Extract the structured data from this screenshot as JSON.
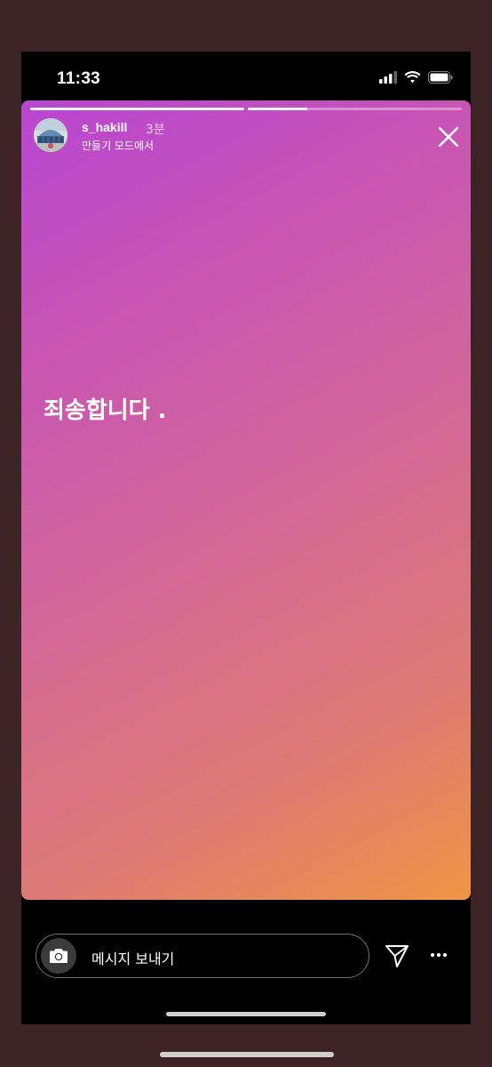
{
  "status_bar": {
    "time": "11:33",
    "icons": [
      "cellular-signal-icon",
      "wifi-icon",
      "battery-icon"
    ]
  },
  "story": {
    "segments_progress": [
      1.0,
      0.28
    ],
    "username": "s_hakill",
    "time_ago": "3분",
    "subtitle": "만들기 모드에서",
    "text": "죄송합니다 .",
    "gradient_colors": [
      "#b746d2",
      "#d2679a",
      "#ee9544"
    ]
  },
  "footer": {
    "message_placeholder": "메시지 보내기",
    "icons": [
      "camera-icon",
      "send-icon",
      "more-icon"
    ]
  }
}
